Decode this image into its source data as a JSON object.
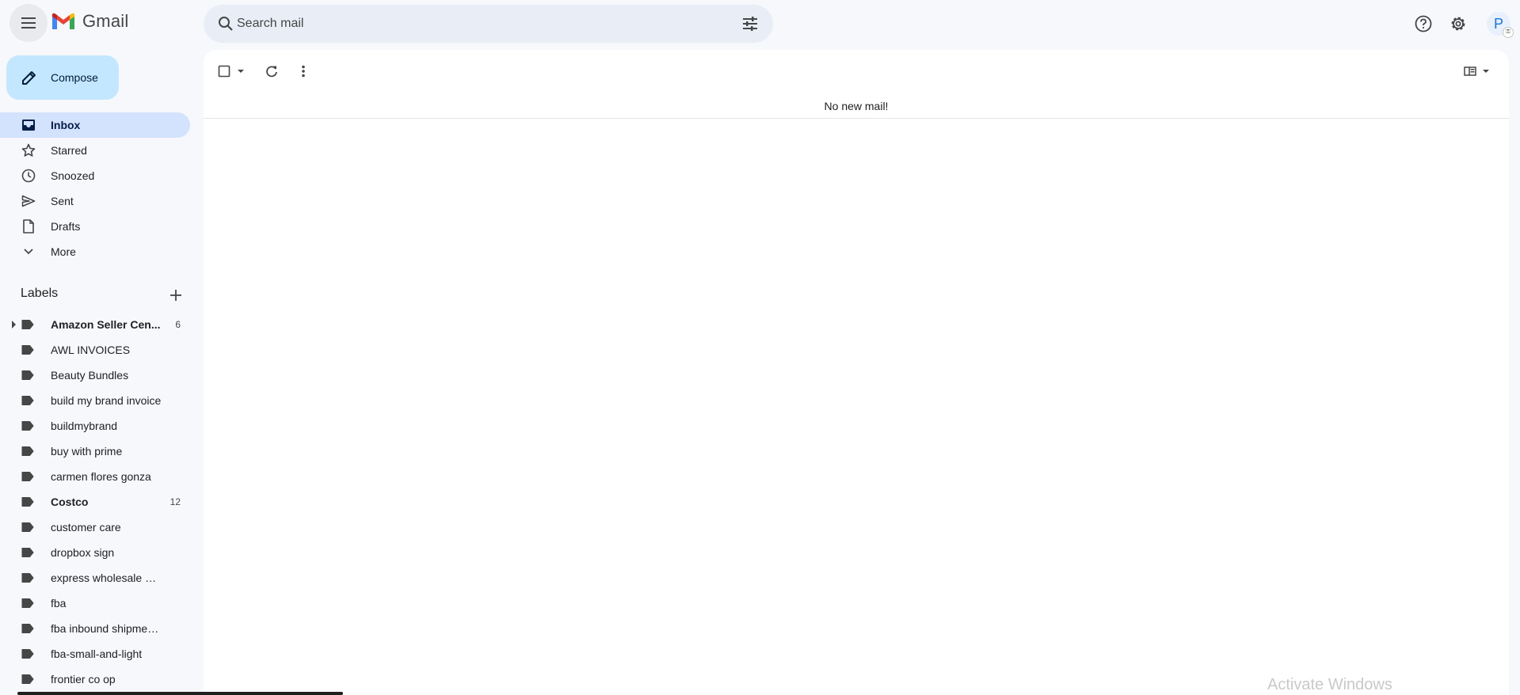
{
  "app": {
    "name": "Gmail"
  },
  "header": {
    "menu_icon": "hamburger-menu-icon",
    "search_placeholder": "Search mail",
    "avatar_initial": "P"
  },
  "sidebar": {
    "compose_label": "Compose",
    "nav": [
      {
        "label": "Inbox",
        "icon": "inbox-icon",
        "active": true
      },
      {
        "label": "Starred",
        "icon": "star-icon"
      },
      {
        "label": "Snoozed",
        "icon": "clock-icon"
      },
      {
        "label": "Sent",
        "icon": "send-icon"
      },
      {
        "label": "Drafts",
        "icon": "draft-icon"
      },
      {
        "label": "More",
        "icon": "chevron-down-icon"
      }
    ],
    "labels_heading": "Labels",
    "labels": [
      {
        "name": "Amazon Seller Cen...",
        "count": "6",
        "bold": true,
        "expandable": true
      },
      {
        "name": "AWL INVOICES"
      },
      {
        "name": "Beauty Bundles"
      },
      {
        "name": "build my brand invoice"
      },
      {
        "name": "buildmybrand"
      },
      {
        "name": "buy with prime"
      },
      {
        "name": "carmen flores gonza"
      },
      {
        "name": "Costco",
        "count": "12",
        "bold": true
      },
      {
        "name": "customer care"
      },
      {
        "name": "dropbox sign"
      },
      {
        "name": "express wholesale b inv..."
      },
      {
        "name": "fba"
      },
      {
        "name": "fba inbound shipment b..."
      },
      {
        "name": "fba-small-and-light"
      },
      {
        "name": "frontier co op"
      }
    ]
  },
  "main": {
    "empty_message": "No new mail!"
  },
  "overlay": {
    "watermark": "Activate Windows"
  },
  "colors": {
    "accent": "#c2e7ff",
    "active_nav": "#d3e3fd",
    "background": "#f6f8fc"
  }
}
